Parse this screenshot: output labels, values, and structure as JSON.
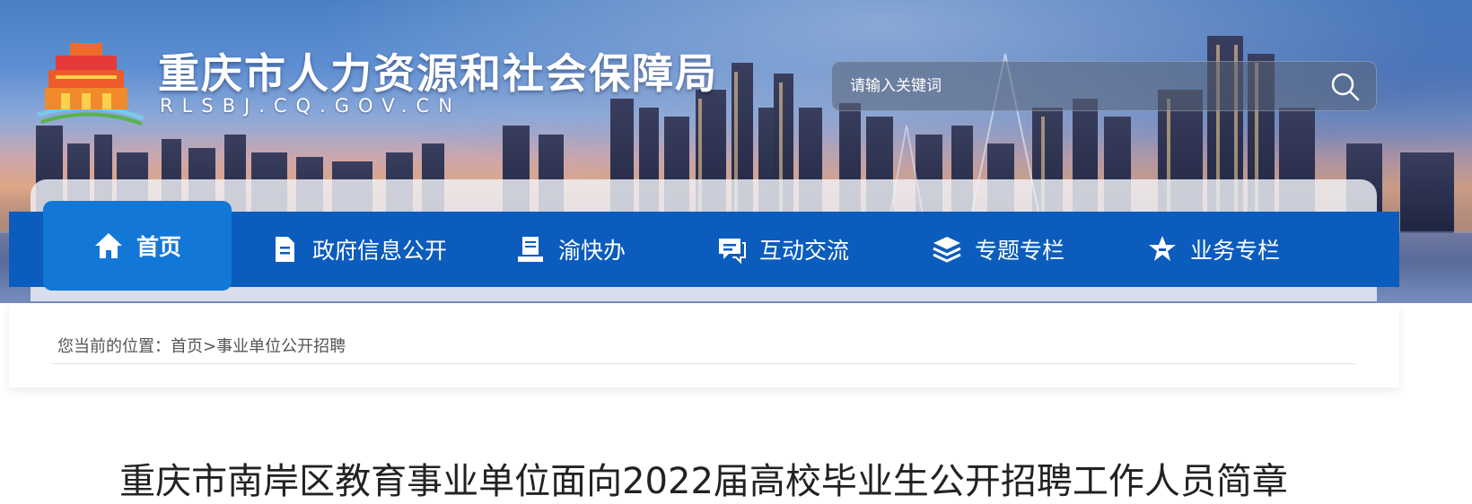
{
  "header": {
    "site_title": "重庆市人力资源和社会保障局",
    "site_domain": "RLSBJ.CQ.GOV.CN",
    "logo_icon": "tiananmen-gate-logo-icon"
  },
  "search": {
    "placeholder": "请输入关键词",
    "icon": "search-icon"
  },
  "nav": {
    "items": [
      {
        "label": "首页",
        "icon": "home-icon",
        "active": true
      },
      {
        "label": "政府信息公开",
        "icon": "document-icon"
      },
      {
        "label": "渝快办",
        "icon": "service-desk-icon"
      },
      {
        "label": "互动交流",
        "icon": "chat-icon"
      },
      {
        "label": "专题专栏",
        "icon": "layers-icon"
      },
      {
        "label": "业务专栏",
        "icon": "star-hand-icon"
      }
    ]
  },
  "breadcrumb": {
    "prefix": "您当前的位置：",
    "home": "首页",
    "separator": ">",
    "current": "事业单位公开招聘"
  },
  "article": {
    "title": "重庆市南岸区教育事业单位面向2022届高校毕业生公开招聘工作人员简章"
  },
  "colors": {
    "nav_blue": "#0b5cbc",
    "nav_active": "#1377d6"
  }
}
